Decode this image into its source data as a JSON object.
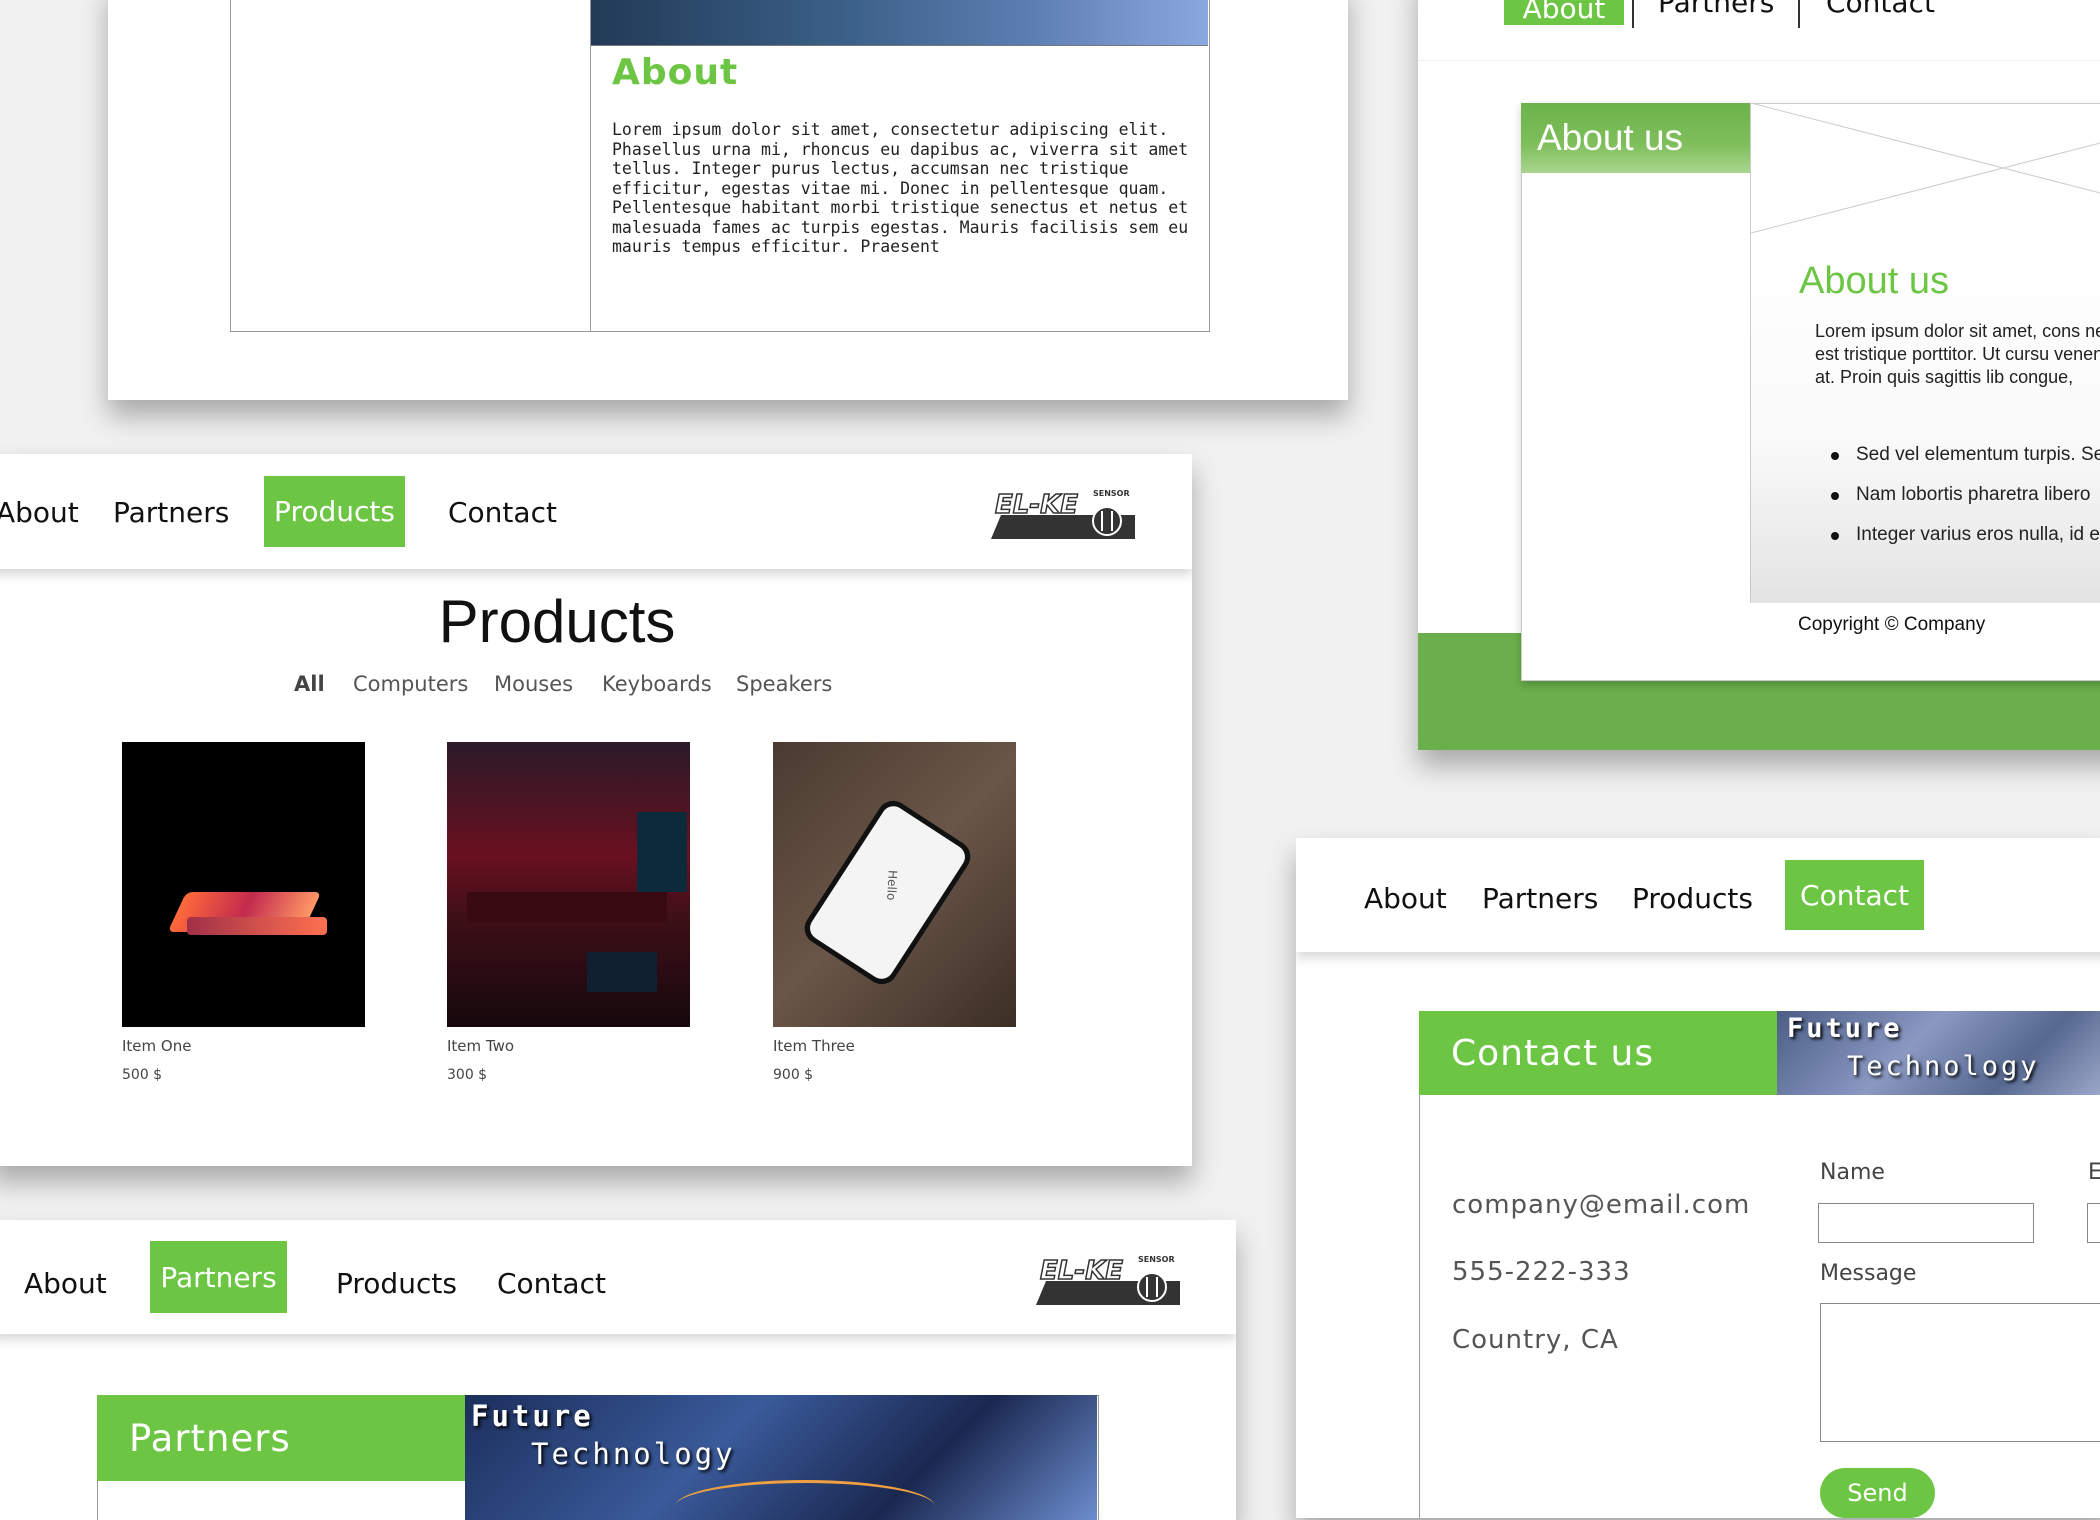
{
  "colors": {
    "accent": "#6cc644",
    "footer": "#6aaf4b"
  },
  "about_card": {
    "heading": "About",
    "body": "Lorem ipsum dolor sit amet, consectetur adipiscing elit. Phasellus urna mi, rhoncus eu dapibus ac, viverra sit amet tellus. Integer purus lectus, accumsan nec tristique efficitur, egestas vitae mi. Donec in pellentesque quam. Pellentesque habitant morbi tristique senectus et netus et malesuada fames ac turpis egestas. Mauris facilisis sem eu mauris tempus efficitur. Praesent"
  },
  "products_card": {
    "nav": {
      "about": "About",
      "partners": "Partners",
      "products": "Products",
      "contact": "Contact"
    },
    "title": "Products",
    "filters": [
      "All",
      "Computers",
      "Mouses",
      "Keyboards",
      "Speakers"
    ],
    "items": [
      {
        "name": "Item One",
        "price": "500 $"
      },
      {
        "name": "Item Two",
        "price": "300 $"
      },
      {
        "name": "Item Three",
        "price": "900 $"
      }
    ],
    "phone_text": "Hello"
  },
  "partners_card": {
    "nav": {
      "about": "About",
      "partners": "Partners",
      "products": "Products",
      "contact": "Contact"
    },
    "heading": "Partners",
    "banner_line1": "Future",
    "banner_line2": "Technology"
  },
  "aboutus_card": {
    "nav": {
      "about": "About",
      "partners": "Partners",
      "contact": "Contact"
    },
    "side_heading": "About us",
    "heading": "About us",
    "body": "Lorem ipsum dolor sit amet, cons nec est tristique porttitor. Ut cursu venenatis at. Proin quis sagittis lib congue,",
    "bullets": [
      "Sed vel elementum turpis. Se",
      "Nam lobortis pharetra libero",
      "Integer varius eros nulla, id e"
    ],
    "footer": "Copyright © Company"
  },
  "contact_card": {
    "nav": {
      "about": "About",
      "partners": "Partners",
      "products": "Products",
      "contact": "Contact"
    },
    "heading": "Contact us",
    "banner_line1": "Future",
    "banner_line2": "Technology",
    "email": "company@email.com",
    "phone": "555-222-333",
    "location": "Country, CA",
    "name_label": "Name",
    "email_label": "E",
    "message_label": "Message",
    "send_label": "Send"
  },
  "logo": {
    "text": "EL-KE",
    "sub": "SENSOR"
  }
}
